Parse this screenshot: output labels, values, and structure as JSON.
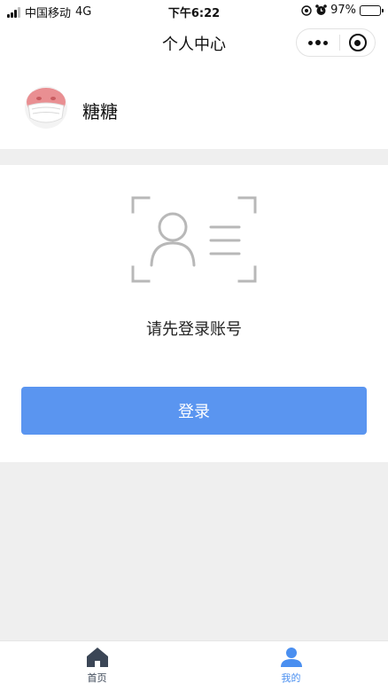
{
  "status_bar": {
    "carrier": "中国移动",
    "network": "4G",
    "time": "下午6:22",
    "battery": "97%",
    "battery_level": 0.97
  },
  "nav": {
    "title": "个人中心"
  },
  "user": {
    "name": "糖糖"
  },
  "login": {
    "prompt": "请先登录账号",
    "button_label": "登录"
  },
  "tabs": [
    {
      "label": "首页",
      "icon": "home-icon",
      "active": false
    },
    {
      "label": "我的",
      "icon": "user-icon",
      "active": true
    }
  ],
  "colors": {
    "accent": "#5a95f0",
    "tab_active": "#4a8ff0",
    "tab_inactive": "#3b4656",
    "background": "#efefef"
  }
}
